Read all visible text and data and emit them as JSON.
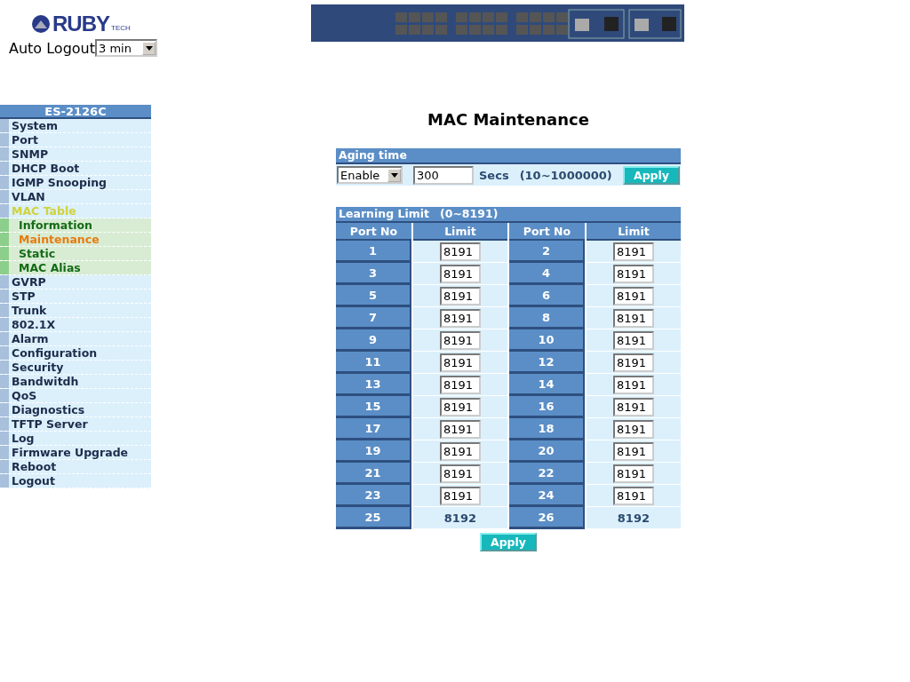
{
  "logo": {
    "word": "RUBY",
    "suffix": "TECH"
  },
  "auto_logout": {
    "label": "Auto Logout",
    "value": "3 min"
  },
  "menu": {
    "title": "ES-2126C",
    "items": [
      {
        "label": "System",
        "selected": false
      },
      {
        "label": "Port",
        "selected": false
      },
      {
        "label": "SNMP",
        "selected": false
      },
      {
        "label": "DHCP Boot",
        "selected": false
      },
      {
        "label": "IGMP Snooping",
        "selected": false
      },
      {
        "label": "VLAN",
        "selected": false
      },
      {
        "label": "MAC Table",
        "selected": false,
        "expanded": true,
        "children": [
          {
            "label": "Information",
            "selected": false
          },
          {
            "label": "Maintenance",
            "selected": true
          },
          {
            "label": "Static",
            "selected": false
          },
          {
            "label": "MAC Alias",
            "selected": false
          }
        ]
      },
      {
        "label": "GVRP",
        "selected": false
      },
      {
        "label": "STP",
        "selected": false
      },
      {
        "label": "Trunk",
        "selected": false
      },
      {
        "label": "802.1X",
        "selected": false
      },
      {
        "label": "Alarm",
        "selected": false
      },
      {
        "label": "Configuration",
        "selected": false
      },
      {
        "label": "Security",
        "selected": false
      },
      {
        "label": "Bandwitdh",
        "selected": false
      },
      {
        "label": "QoS",
        "selected": false
      },
      {
        "label": "Diagnostics",
        "selected": false
      },
      {
        "label": "TFTP Server",
        "selected": false
      },
      {
        "label": "Log",
        "selected": false
      },
      {
        "label": "Firmware Upgrade",
        "selected": false
      },
      {
        "label": "Reboot",
        "selected": false
      },
      {
        "label": "Logout",
        "selected": false
      }
    ]
  },
  "title": "MAC Maintenance",
  "aging": {
    "header": "Aging time",
    "mode": "Enable",
    "value": "300",
    "unit": "Secs",
    "range": "(10~1000000)",
    "button": "Apply"
  },
  "learning": {
    "header": "Learning Limit",
    "range": "(0~8191)",
    "columns": [
      "Port No",
      "Limit",
      "Port No",
      "Limit"
    ],
    "rows": [
      [
        {
          "port": "1",
          "limit": "8191",
          "kind": "input"
        },
        {
          "port": "2",
          "limit": "8191",
          "kind": "input"
        }
      ],
      [
        {
          "port": "3",
          "limit": "8191",
          "kind": "input"
        },
        {
          "port": "4",
          "limit": "8191",
          "kind": "input"
        }
      ],
      [
        {
          "port": "5",
          "limit": "8191",
          "kind": "input"
        },
        {
          "port": "6",
          "limit": "8191",
          "kind": "input"
        }
      ],
      [
        {
          "port": "7",
          "limit": "8191",
          "kind": "input"
        },
        {
          "port": "8",
          "limit": "8191",
          "kind": "input"
        }
      ],
      [
        {
          "port": "9",
          "limit": "8191",
          "kind": "input"
        },
        {
          "port": "10",
          "limit": "8191",
          "kind": "input"
        }
      ],
      [
        {
          "port": "11",
          "limit": "8191",
          "kind": "input"
        },
        {
          "port": "12",
          "limit": "8191",
          "kind": "input"
        }
      ],
      [
        {
          "port": "13",
          "limit": "8191",
          "kind": "input"
        },
        {
          "port": "14",
          "limit": "8191",
          "kind": "input"
        }
      ],
      [
        {
          "port": "15",
          "limit": "8191",
          "kind": "input"
        },
        {
          "port": "16",
          "limit": "8191",
          "kind": "input"
        }
      ],
      [
        {
          "port": "17",
          "limit": "8191",
          "kind": "input"
        },
        {
          "port": "18",
          "limit": "8191",
          "kind": "input"
        }
      ],
      [
        {
          "port": "19",
          "limit": "8191",
          "kind": "input"
        },
        {
          "port": "20",
          "limit": "8191",
          "kind": "input"
        }
      ],
      [
        {
          "port": "21",
          "limit": "8191",
          "kind": "input"
        },
        {
          "port": "22",
          "limit": "8191",
          "kind": "input"
        }
      ],
      [
        {
          "port": "23",
          "limit": "8191",
          "kind": "input"
        },
        {
          "port": "24",
          "limit": "8191",
          "kind": "input"
        }
      ],
      [
        {
          "port": "25",
          "limit": "8192",
          "kind": "text"
        },
        {
          "port": "26",
          "limit": "8192",
          "kind": "text"
        }
      ]
    ],
    "button": "Apply"
  }
}
